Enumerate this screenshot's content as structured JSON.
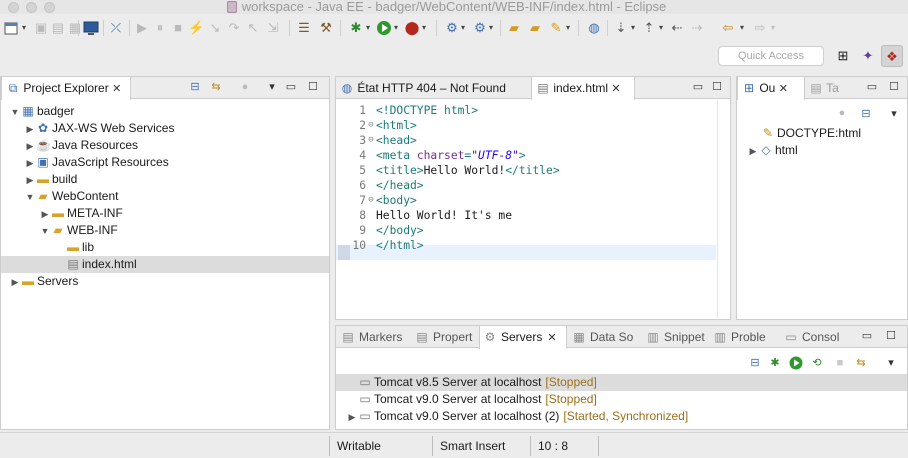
{
  "window": {
    "title": "workspace - Java EE - badger/WebContent/WEB-INF/index.html - Eclipse"
  },
  "toolbar": {
    "icons": [
      "new-wizard-icon",
      "save-icon",
      "save-all-icon",
      "open-console-icon",
      "skip-breakpoints-icon",
      "resume-icon",
      "suspend-icon",
      "terminate-icon",
      "disconnect-icon",
      "step-into-icon",
      "step-over-icon",
      "step-return-icon",
      "tasks-icon",
      "build-icon",
      "debug-icon",
      "run-icon",
      "external-tools-icon",
      "new-web-service-icon",
      "new-web-server-icon",
      "open-type-icon",
      "open-task-icon",
      "search-icon",
      "globe-icon",
      "next-annotation-icon",
      "prev-annotation-icon",
      "back-icon",
      "forward-icon"
    ]
  },
  "quick_access": {
    "placeholder": "Quick Access"
  },
  "explorer": {
    "tab_label": "Project Explorer",
    "tree": [
      {
        "label": "badger",
        "depth": 0,
        "expanded": true,
        "icon": "project-icon"
      },
      {
        "label": "JAX-WS Web Services",
        "depth": 1,
        "expanded": false,
        "icon": "web-services-icon"
      },
      {
        "label": "Java Resources",
        "depth": 1,
        "expanded": false,
        "icon": "java-resources-icon"
      },
      {
        "label": "JavaScript Resources",
        "depth": 1,
        "expanded": false,
        "icon": "javascript-resources-icon"
      },
      {
        "label": "build",
        "depth": 1,
        "expanded": false,
        "icon": "folder-icon"
      },
      {
        "label": "WebContent",
        "depth": 1,
        "expanded": true,
        "icon": "folder-open-icon"
      },
      {
        "label": "META-INF",
        "depth": 2,
        "expanded": false,
        "icon": "folder-icon"
      },
      {
        "label": "WEB-INF",
        "depth": 2,
        "expanded": true,
        "icon": "folder-open-icon"
      },
      {
        "label": "lib",
        "depth": 3,
        "expanded": null,
        "icon": "folder-icon"
      },
      {
        "label": "index.html",
        "depth": 3,
        "expanded": null,
        "icon": "html-file-icon",
        "selected": true
      },
      {
        "label": "Servers",
        "depth": 0,
        "expanded": false,
        "icon": "folder-icon"
      }
    ]
  },
  "editor": {
    "tabs": [
      {
        "label": "État HTTP 404 – Not Found",
        "icon": "browser-icon",
        "active": false
      },
      {
        "label": "index.html",
        "icon": "html-file-icon",
        "active": true
      }
    ],
    "line_numbers": [
      "1",
      "2",
      "3",
      "4",
      "5",
      "6",
      "7",
      "8",
      "9",
      "10"
    ],
    "lines": [
      {
        "tokens": [
          [
            "tag",
            "<!DOCTYPE html>"
          ]
        ]
      },
      {
        "tokens": [
          [
            "tag",
            "<html>"
          ]
        ]
      },
      {
        "tokens": [
          [
            "tag",
            "<head>"
          ]
        ]
      },
      {
        "tokens": [
          [
            "tag",
            "<meta "
          ],
          [
            "attr",
            "charset"
          ],
          [
            "tag",
            "="
          ],
          [
            "val",
            "\"UTF-8\""
          ],
          [
            "tag",
            ">"
          ]
        ]
      },
      {
        "tokens": [
          [
            "tag",
            "<title>"
          ],
          [
            "text",
            "Hello World!"
          ],
          [
            "tag",
            "</title>"
          ]
        ]
      },
      {
        "tokens": [
          [
            "tag",
            "</head>"
          ]
        ]
      },
      {
        "tokens": [
          [
            "tag",
            "<body>"
          ]
        ]
      },
      {
        "tokens": [
          [
            "text",
            "Hello World! It's me"
          ]
        ]
      },
      {
        "tokens": [
          [
            "tag",
            "</body>"
          ]
        ]
      },
      {
        "tokens": [
          [
            "tag",
            "</html>"
          ]
        ]
      }
    ],
    "folded_lines": [
      2,
      3,
      7
    ]
  },
  "outline": {
    "tabs": [
      {
        "label": "Ou",
        "active": true
      },
      {
        "label": "Ta",
        "active": false
      }
    ],
    "items": [
      {
        "label": "DOCTYPE:html",
        "expandable": false,
        "icon": "doctype-icon"
      },
      {
        "label": "html",
        "expandable": true,
        "icon": "element-icon"
      }
    ]
  },
  "bottom": {
    "tabs": [
      {
        "label": "Markers",
        "icon": "markers-icon"
      },
      {
        "label": "Propert",
        "icon": "properties-icon"
      },
      {
        "label": "Servers",
        "icon": "servers-icon",
        "active": true
      },
      {
        "label": "Data So",
        "icon": "data-source-icon"
      },
      {
        "label": "Snippet",
        "icon": "snippets-icon"
      },
      {
        "label": "Proble",
        "icon": "problems-icon"
      },
      {
        "label": "Consol",
        "icon": "console-icon"
      }
    ],
    "servers": [
      {
        "name": "Tomcat v8.5 Server at localhost",
        "state": "[Stopped]",
        "expandable": false,
        "selected": true
      },
      {
        "name": "Tomcat v9.0 Server at localhost",
        "state": "[Stopped]",
        "expandable": false
      },
      {
        "name": "Tomcat v9.0 Server at localhost (2)",
        "state": "[Started, Synchronized]",
        "expandable": true
      }
    ]
  },
  "status": {
    "writable": "Writable",
    "insert_mode": "Smart Insert",
    "position": "10 : 8"
  }
}
